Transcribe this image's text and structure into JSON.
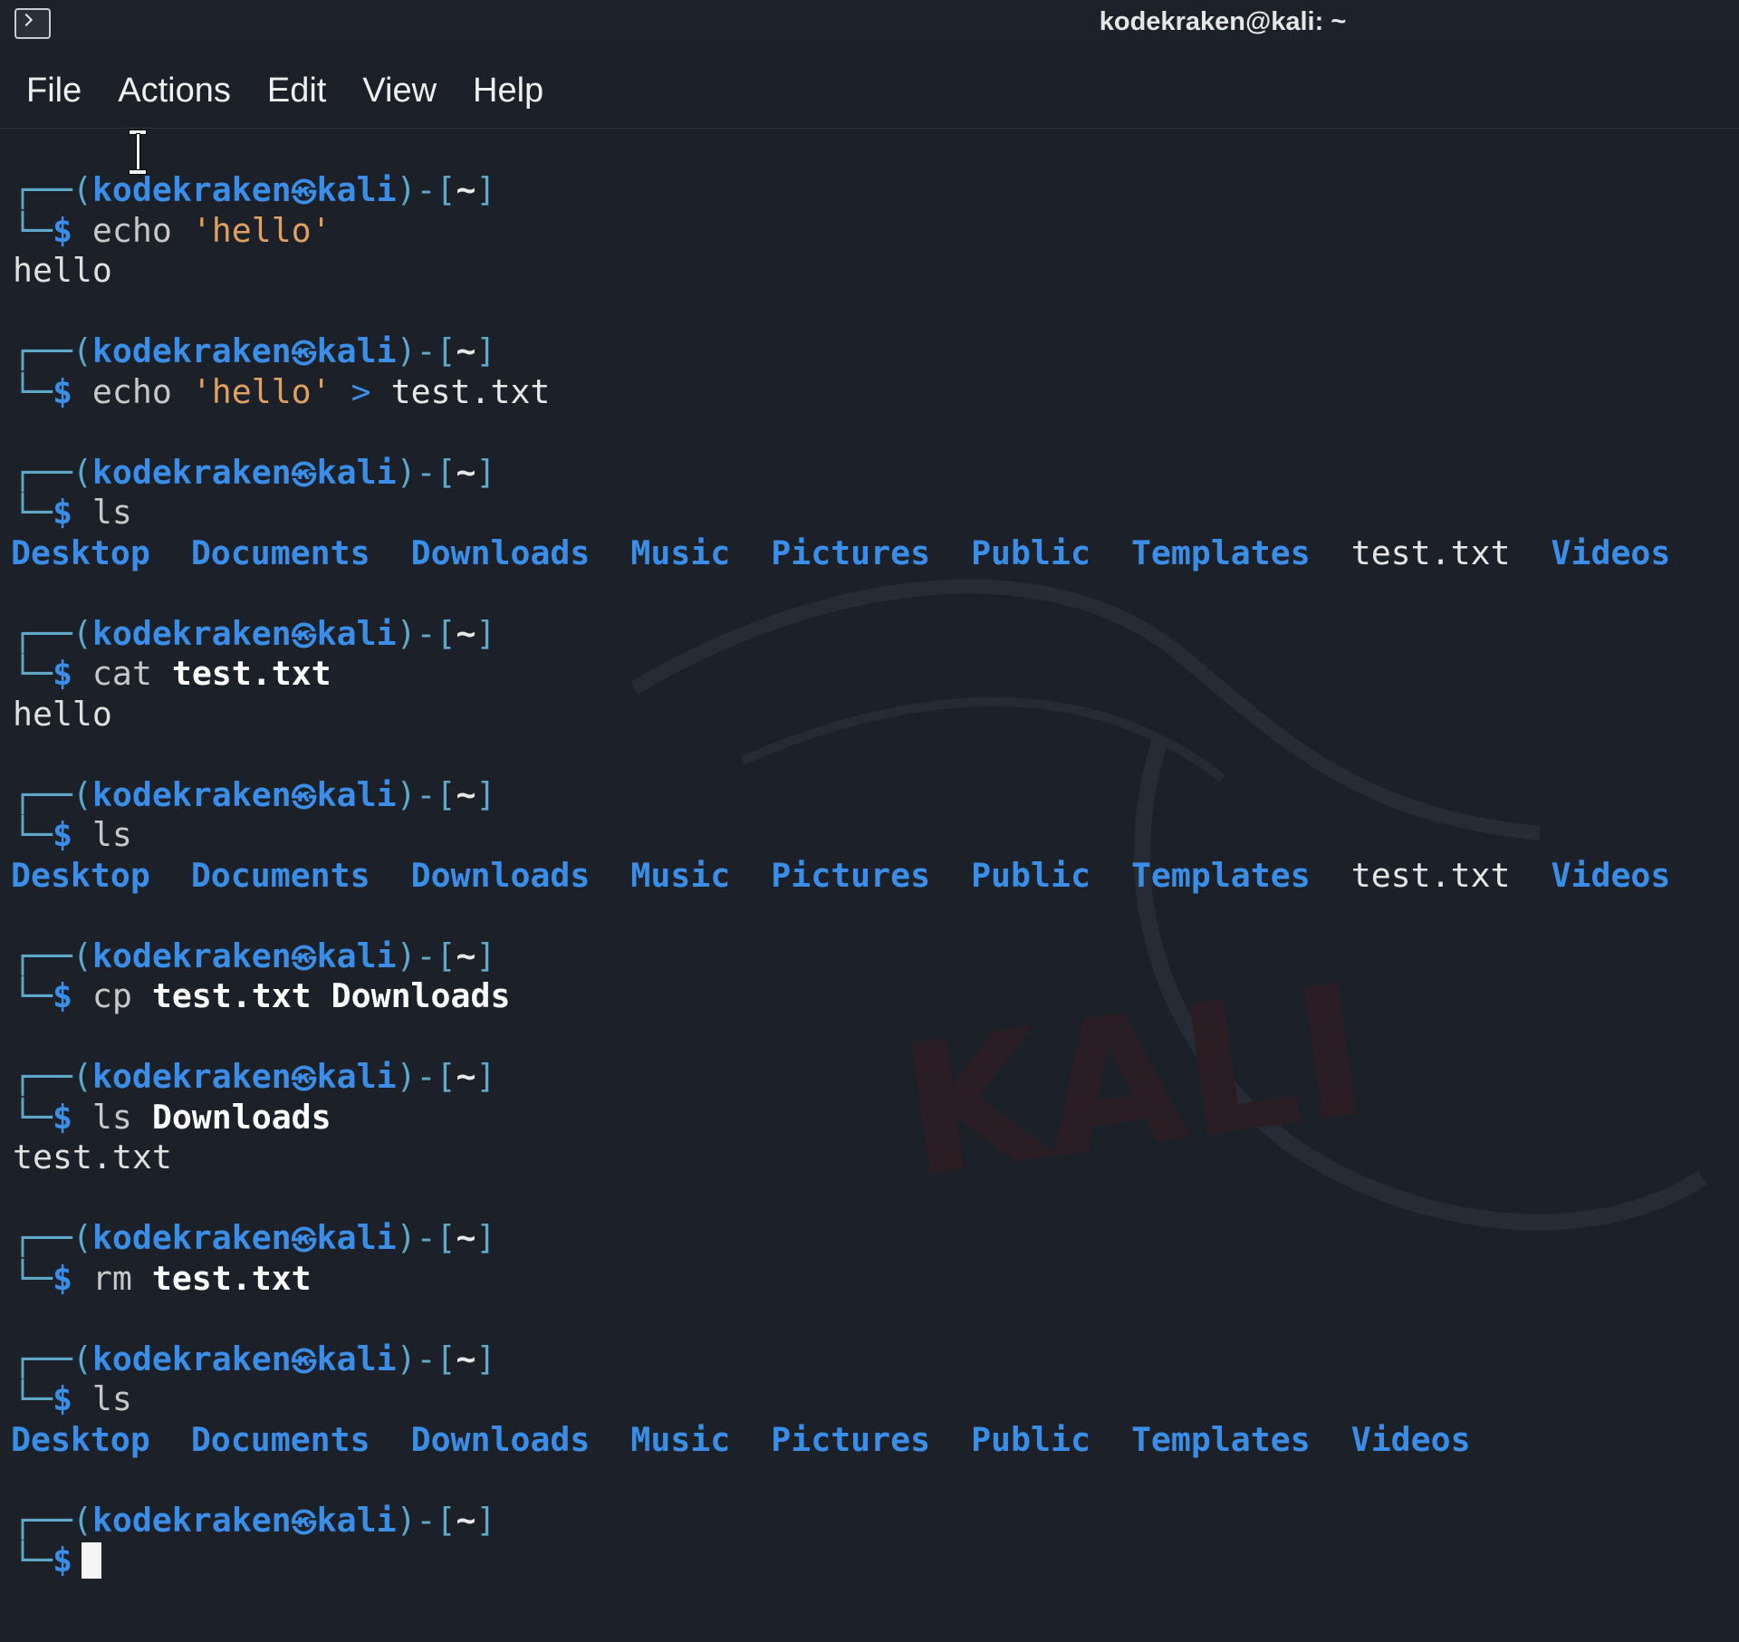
{
  "window": {
    "title": "kodekraken@kali: ~"
  },
  "menu": [
    "File",
    "Actions",
    "Edit",
    "View",
    "Help"
  ],
  "prompt": {
    "user": "kodekraken",
    "symbol": "㉿",
    "host": "kali",
    "dir": "~",
    "corner_top": "┌──(",
    "close_paren": ")-[",
    "close_bracket": "]",
    "corner_bottom": "└─",
    "dollar": "$"
  },
  "colors": {
    "background": "#1c2029",
    "prompt_blue": "#3b8ee8",
    "prompt_frame": "#5fa8c8",
    "string_orange": "#e0a060"
  },
  "session": [
    {
      "cmd": "echo",
      "args": [
        {
          "t": "'hello'",
          "k": "str"
        }
      ],
      "output": [
        "hello"
      ]
    },
    {
      "cmd": "echo",
      "args": [
        {
          "t": "'hello'",
          "k": "str"
        },
        {
          "t": ">",
          "k": "op"
        },
        {
          "t": "test.txt",
          "k": "arg"
        }
      ],
      "output": []
    },
    {
      "cmd": "ls",
      "args": [],
      "ls": [
        {
          "t": "Desktop",
          "k": "dir"
        },
        {
          "t": "Documents",
          "k": "dir"
        },
        {
          "t": "Downloads",
          "k": "dir"
        },
        {
          "t": "Music",
          "k": "dir"
        },
        {
          "t": "Pictures",
          "k": "dir"
        },
        {
          "t": "Public",
          "k": "dir"
        },
        {
          "t": "Templates",
          "k": "dir"
        },
        {
          "t": "test.txt",
          "k": "file"
        },
        {
          "t": "Videos",
          "k": "dir"
        }
      ]
    },
    {
      "cmd": "cat",
      "args": [
        {
          "t": "test.txt",
          "k": "argb"
        }
      ],
      "output": [
        "hello"
      ]
    },
    {
      "cmd": "ls",
      "args": [],
      "ls": [
        {
          "t": "Desktop",
          "k": "dir"
        },
        {
          "t": "Documents",
          "k": "dir"
        },
        {
          "t": "Downloads",
          "k": "dir"
        },
        {
          "t": "Music",
          "k": "dir"
        },
        {
          "t": "Pictures",
          "k": "dir"
        },
        {
          "t": "Public",
          "k": "dir"
        },
        {
          "t": "Templates",
          "k": "dir"
        },
        {
          "t": "test.txt",
          "k": "file"
        },
        {
          "t": "Videos",
          "k": "dir"
        }
      ]
    },
    {
      "cmd": "cp",
      "args": [
        {
          "t": "test.txt",
          "k": "argb"
        },
        {
          "t": "Downloads",
          "k": "argb"
        }
      ],
      "output": []
    },
    {
      "cmd": "ls",
      "args": [
        {
          "t": "Downloads",
          "k": "argb"
        }
      ],
      "output": [
        "test.txt"
      ]
    },
    {
      "cmd": "rm",
      "args": [
        {
          "t": "test.txt",
          "k": "argb"
        }
      ],
      "output": []
    },
    {
      "cmd": "ls",
      "args": [],
      "ls": [
        {
          "t": "Desktop",
          "k": "dir"
        },
        {
          "t": "Documents",
          "k": "dir"
        },
        {
          "t": "Downloads",
          "k": "dir"
        },
        {
          "t": "Music",
          "k": "dir"
        },
        {
          "t": "Pictures",
          "k": "dir"
        },
        {
          "t": "Public",
          "k": "dir"
        },
        {
          "t": "Templates",
          "k": "dir"
        },
        {
          "t": "Videos",
          "k": "dir"
        }
      ]
    },
    {
      "cmd": "",
      "args": [],
      "output": [],
      "active": true
    }
  ]
}
